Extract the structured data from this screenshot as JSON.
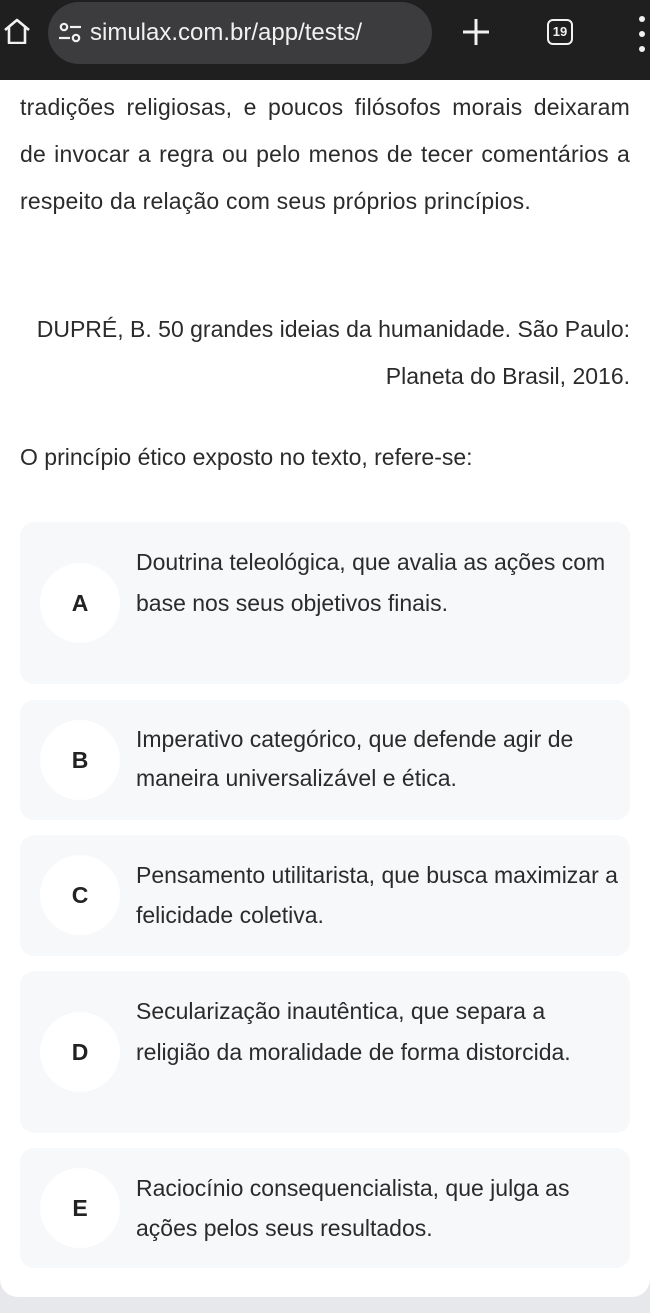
{
  "browser": {
    "url": "simulax.com.br/app/tests/",
    "tab_count": "19",
    "icons": {
      "home": "home-icon",
      "site_info": "tune-icon",
      "new_tab": "plus-icon",
      "menu": "more-vertical-icon"
    }
  },
  "passage": {
    "text": "tradições religiosas, e poucos filósofos morais deixaram de invocar a regra ou pelo menos de tecer comentários a respeito da relação com seus próprios princípios.",
    "citation": "DUPRÉ, B. 50 grandes ideias da humanidade. São Paulo: Planeta do Brasil, 2016."
  },
  "question": {
    "prompt": "O princípio ético exposto no texto, refere-se:"
  },
  "options": [
    {
      "letter": "A",
      "text": "Doutrina teleológica, que avalia as ações com base nos seus objetivos finais."
    },
    {
      "letter": "B",
      "text": "Imperativo categórico, que defende agir de maneira universalizável e ética."
    },
    {
      "letter": "C",
      "text": "Pensamento utilitarista, que busca maximizar a felicidade coletiva."
    },
    {
      "letter": "D",
      "text": "Secularização inautêntica, que separa a religião da moralidade de forma distorcida."
    },
    {
      "letter": "E",
      "text": "Raciocínio consequencialista, que julga as ações pelos seus resultados."
    }
  ],
  "colors": {
    "toolbar_bg": "#1f1f1f",
    "url_pill_bg": "#3c3c3e",
    "option_bg": "#f7f8fa",
    "text": "#2b2b2b"
  }
}
